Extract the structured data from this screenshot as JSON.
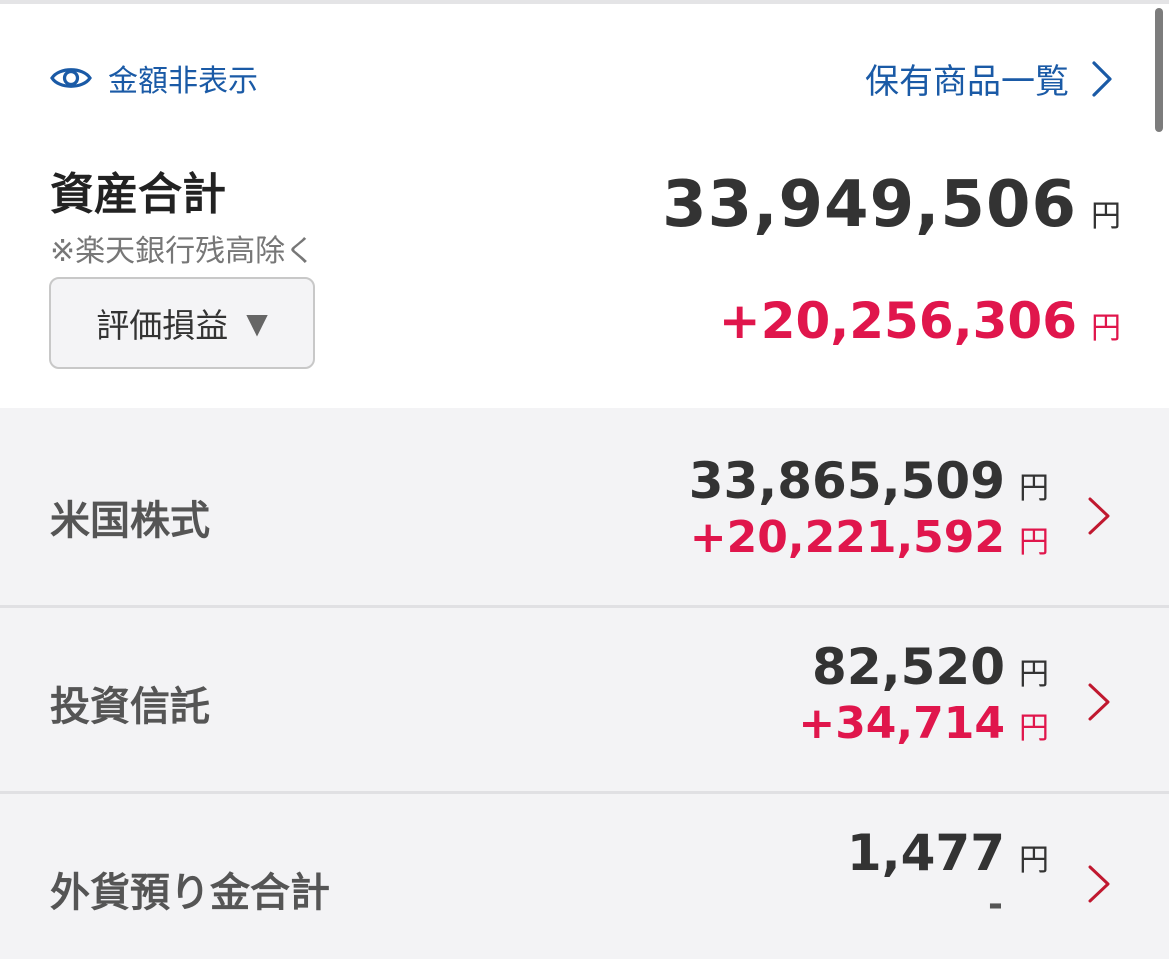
{
  "header": {
    "hide_amount_label": "金額非表示",
    "holdings_link_label": "保有商品一覧"
  },
  "total": {
    "title": "資産合計",
    "note": "※楽天銀行残高除く",
    "amount": "33,949,506",
    "amount_unit": "円",
    "gain": "+20,256,306",
    "gain_unit": "円"
  },
  "view_select": {
    "selected": "評価損益",
    "caret": "▼"
  },
  "categories": [
    {
      "label": "米国株式",
      "amount": "33,865,509",
      "amount_unit": "円",
      "gain": "+20,221,592",
      "gain_unit": "円"
    },
    {
      "label": "投資信託",
      "amount": "82,520",
      "amount_unit": "円",
      "gain": "+34,714",
      "gain_unit": "円"
    },
    {
      "label": "外貨預り金合計",
      "amount": "1,477",
      "amount_unit": "円",
      "gain": "-"
    }
  ],
  "colors": {
    "link": "#1a5aa6",
    "gain": "#e0164c",
    "chevron": "#c0182f",
    "list_background": "#f3f3f5"
  },
  "icons": {
    "hide_amount": "eye-icon",
    "holdings_link": "chevron-right-icon",
    "row_link": "chevron-right-icon",
    "select_caret": "triangle-down"
  }
}
